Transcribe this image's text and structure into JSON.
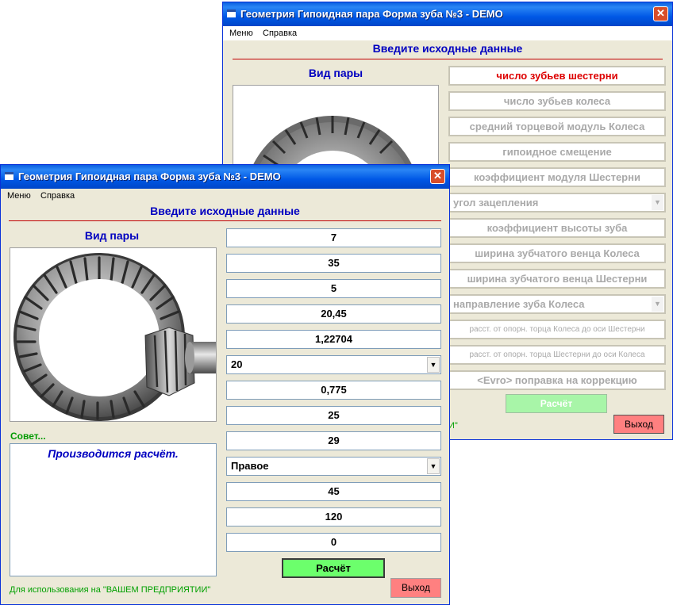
{
  "back_window": {
    "title": "Геометрия Гипоидная пара Форма зуба №3 - DEMO",
    "menu": [
      "Меню",
      "Справка"
    ],
    "header": "Введите исходные данные",
    "vid_pary": "Вид пары",
    "labels": [
      "число зубьев шестерни",
      "число зубьев колеса",
      "средний торцевой модуль Колеса",
      "гипоидное смещение",
      "коэффициент модуля Шестерни",
      "угол зацепления",
      "коэффициент высоты зуба",
      "ширина зубчатого венца Колеса",
      "ширина зубчатого венца Шестерни",
      "направление зуба Колеса",
      "расст. от опорн. торца Колеса до оси Шестерни",
      "расст. от опорн. торца Шестерни до оси Колеса",
      "<Evro> поправка на коррекцию"
    ],
    "footer_fragment": "И\"",
    "calc_button": "Расчёт",
    "exit_button": "Выход",
    "active_label_color": "#dd0000",
    "inactive_label_color": "#a9a9a9"
  },
  "front_window": {
    "title": "Геометрия Гипоидная пара Форма зуба №3 - DEMO",
    "menu": [
      "Меню",
      "Справка"
    ],
    "header": "Введите исходные данные",
    "vid_pary": "Вид пары",
    "fields": [
      "7",
      "35",
      "5",
      "20,45",
      "1,22704",
      "20",
      "0,775",
      "25",
      "29",
      "Правое",
      "45",
      "120",
      "0"
    ],
    "sovet_label": "Совет...",
    "sovet_text": "Производится расчёт.",
    "footer": "Для использования на  \"ВАШЕМ ПРЕДПРИЯТИИ\"",
    "calc_button": "Расчёт",
    "exit_button": "Выход"
  },
  "colors": {
    "title_blue": "#0058e6",
    "heading_blue": "#0000c0",
    "accent_red": "#c00000",
    "calc_green": "#7cff7c",
    "exit_red": "#ff8080",
    "footer_green": "#00a000"
  },
  "icons": [
    "app-icon",
    "close-icon",
    "dropdown-arrow-icon",
    "gear-pair-image"
  ]
}
